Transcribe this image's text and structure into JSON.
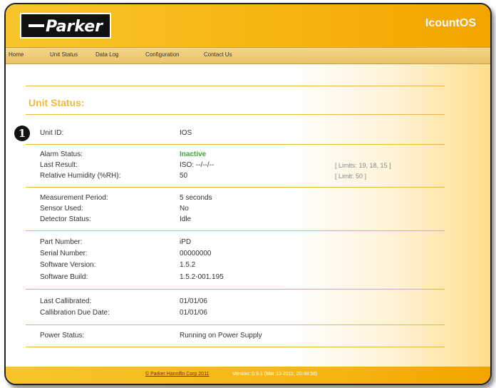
{
  "header": {
    "logo_text": "Parker",
    "product_name": "IcountOS"
  },
  "nav": [
    "Home",
    "Unit Status",
    "Data Log",
    "Configuration",
    "Contact Us"
  ],
  "section_title": "Unit Status:",
  "marker": "1",
  "status": {
    "unit_id": {
      "label": "Unit ID:",
      "value": "IOS"
    },
    "alarm_status": {
      "label": "Alarm Status:",
      "value": "Inactive",
      "value_color": "#3aaa35"
    },
    "last_result": {
      "label": "Last Result:",
      "value": "ISO: --/--/--",
      "limit": "[ Limits: 19, 18, 15 ]"
    },
    "relative_humidity": {
      "label": "Relative Humidity (%RH):",
      "value": "50",
      "limit": "[ Limit: 50 ]"
    },
    "measurement_period": {
      "label": "Measurement Period:",
      "value": "5 seconds"
    },
    "sensor_used": {
      "label": "Sensor Used:",
      "value": "No"
    },
    "detector_status": {
      "label": "Detector Status:",
      "value": "Idle"
    },
    "part_number": {
      "label": "Part Number:",
      "value": "iPD"
    },
    "serial_number": {
      "label": "Serial Number:",
      "value": "00000000"
    },
    "software_version": {
      "label": "Software Version:",
      "value": "1.5.2"
    },
    "software_build": {
      "label": "Software Build:",
      "value": "1.5.2-001.195"
    },
    "last_calibrated": {
      "label": "Last Callibrated:",
      "value": "01/01/06"
    },
    "calibration_due": {
      "label": "Callibration Due Date:",
      "value": "01/01/06"
    },
    "power_status": {
      "label": "Power Status:",
      "value": "Running on Power Supply"
    }
  },
  "footer": {
    "copyright": "© Parker Hannifin Corp 2011",
    "version": "Version: 0.9.1 (Mar 13 2011, 20:48:58)"
  },
  "colors": {
    "brand_yellow": "#f6b40e",
    "accent_orange": "#f2b93c",
    "active_green": "#3aaa35"
  }
}
